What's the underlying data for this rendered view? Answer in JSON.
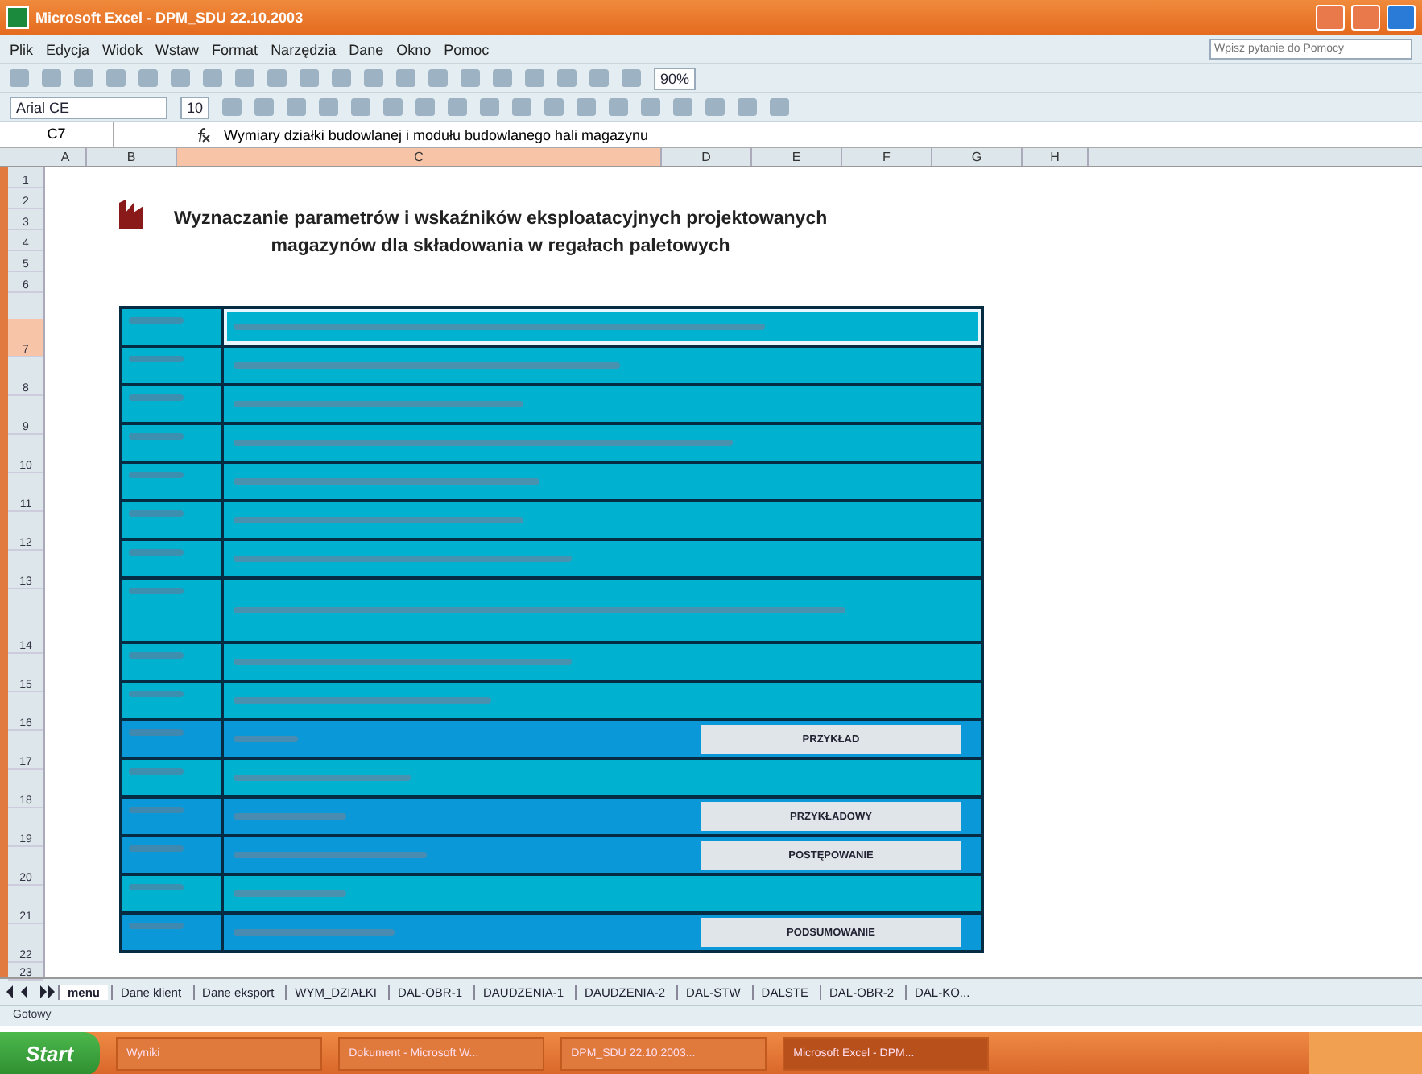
{
  "window": {
    "title": "Microsoft Excel - DPM_SDU 22.10.2003"
  },
  "menu": [
    "Plik",
    "Edycja",
    "Widok",
    "Wstaw",
    "Format",
    "Narzędzia",
    "Dane",
    "Okno",
    "Pomoc"
  ],
  "help_box": {
    "placeholder": "Wpisz pytanie do Pomocy"
  },
  "toolbar": {
    "zoom": "90%",
    "font": "Arial CE",
    "size": "10"
  },
  "formula_bar": {
    "name_box": "C7",
    "formula": "Wymiary działki budowlanej i modułu budowlanego hali magazynu"
  },
  "columns": [
    {
      "label": "A",
      "selected": false
    },
    {
      "label": "B",
      "selected": false
    },
    {
      "label": "C",
      "selected": true
    },
    {
      "label": "D",
      "selected": false
    },
    {
      "label": "E",
      "selected": false
    },
    {
      "label": "F",
      "selected": false
    },
    {
      "label": "G",
      "selected": false
    },
    {
      "label": "H",
      "selected": false
    }
  ],
  "header_rows": [
    "1",
    "2",
    "3",
    "4",
    "5",
    "6"
  ],
  "heading": [
    "Wyznaczanie parametrów  i wskaźników eksploatacyjnych projektowanych",
    "magazynów dla składowania w regałach paletowych"
  ],
  "rows": [
    {
      "num": "7",
      "kind": "plain",
      "selected": true
    },
    {
      "num": "8",
      "kind": "plain",
      "selected": false
    },
    {
      "num": "9",
      "kind": "plain",
      "selected": false
    },
    {
      "num": "10",
      "kind": "plain",
      "selected": false
    },
    {
      "num": "11",
      "kind": "plain",
      "selected": false
    },
    {
      "num": "12",
      "kind": "plain",
      "selected": false
    },
    {
      "num": "13",
      "kind": "plain",
      "selected": false
    },
    {
      "num": "14",
      "kind": "tall",
      "selected": false
    },
    {
      "num": "15",
      "kind": "plain",
      "selected": false
    },
    {
      "num": "16",
      "kind": "plain",
      "selected": false
    },
    {
      "num": "17",
      "kind": "button",
      "selected": false,
      "button": "PRZYKŁAD"
    },
    {
      "num": "18",
      "kind": "plain",
      "selected": false
    },
    {
      "num": "19",
      "kind": "button",
      "selected": false,
      "button": "PRZYKŁADOWY"
    },
    {
      "num": "20",
      "kind": "button",
      "selected": false,
      "button": "POSTĘPOWANIE"
    },
    {
      "num": "21",
      "kind": "plain",
      "selected": false
    },
    {
      "num": "22",
      "kind": "button",
      "selected": false,
      "button": "PODSUMOWANIE"
    }
  ],
  "last_row": "23",
  "sheet_tabs": [
    {
      "label": "menu",
      "selected": true
    },
    {
      "label": "Dane klient",
      "selected": false
    },
    {
      "label": "Dane eksport",
      "selected": false
    },
    {
      "label": "WYM_DZIAŁKI",
      "selected": false
    },
    {
      "label": "DAL-OBR-1",
      "selected": false
    },
    {
      "label": "DAUDZENIA-1",
      "selected": false
    },
    {
      "label": "DAUDZENIA-2",
      "selected": false
    },
    {
      "label": "DAL-STW",
      "selected": false
    },
    {
      "label": "DALSTE",
      "selected": false
    },
    {
      "label": "DAL-OBR-2",
      "selected": false
    },
    {
      "label": "DAL-KO...",
      "selected": false
    }
  ],
  "status_bar": "Gotowy",
  "taskbar": {
    "start": "Start",
    "items": [
      {
        "label": "Wyniki",
        "selected": false
      },
      {
        "label": "Dokument - Microsoft W...",
        "selected": false
      },
      {
        "label": "DPM_SDU 22.10.2003...",
        "selected": false
      },
      {
        "label": "Microsoft Excel - DPM...",
        "selected": true
      }
    ]
  }
}
